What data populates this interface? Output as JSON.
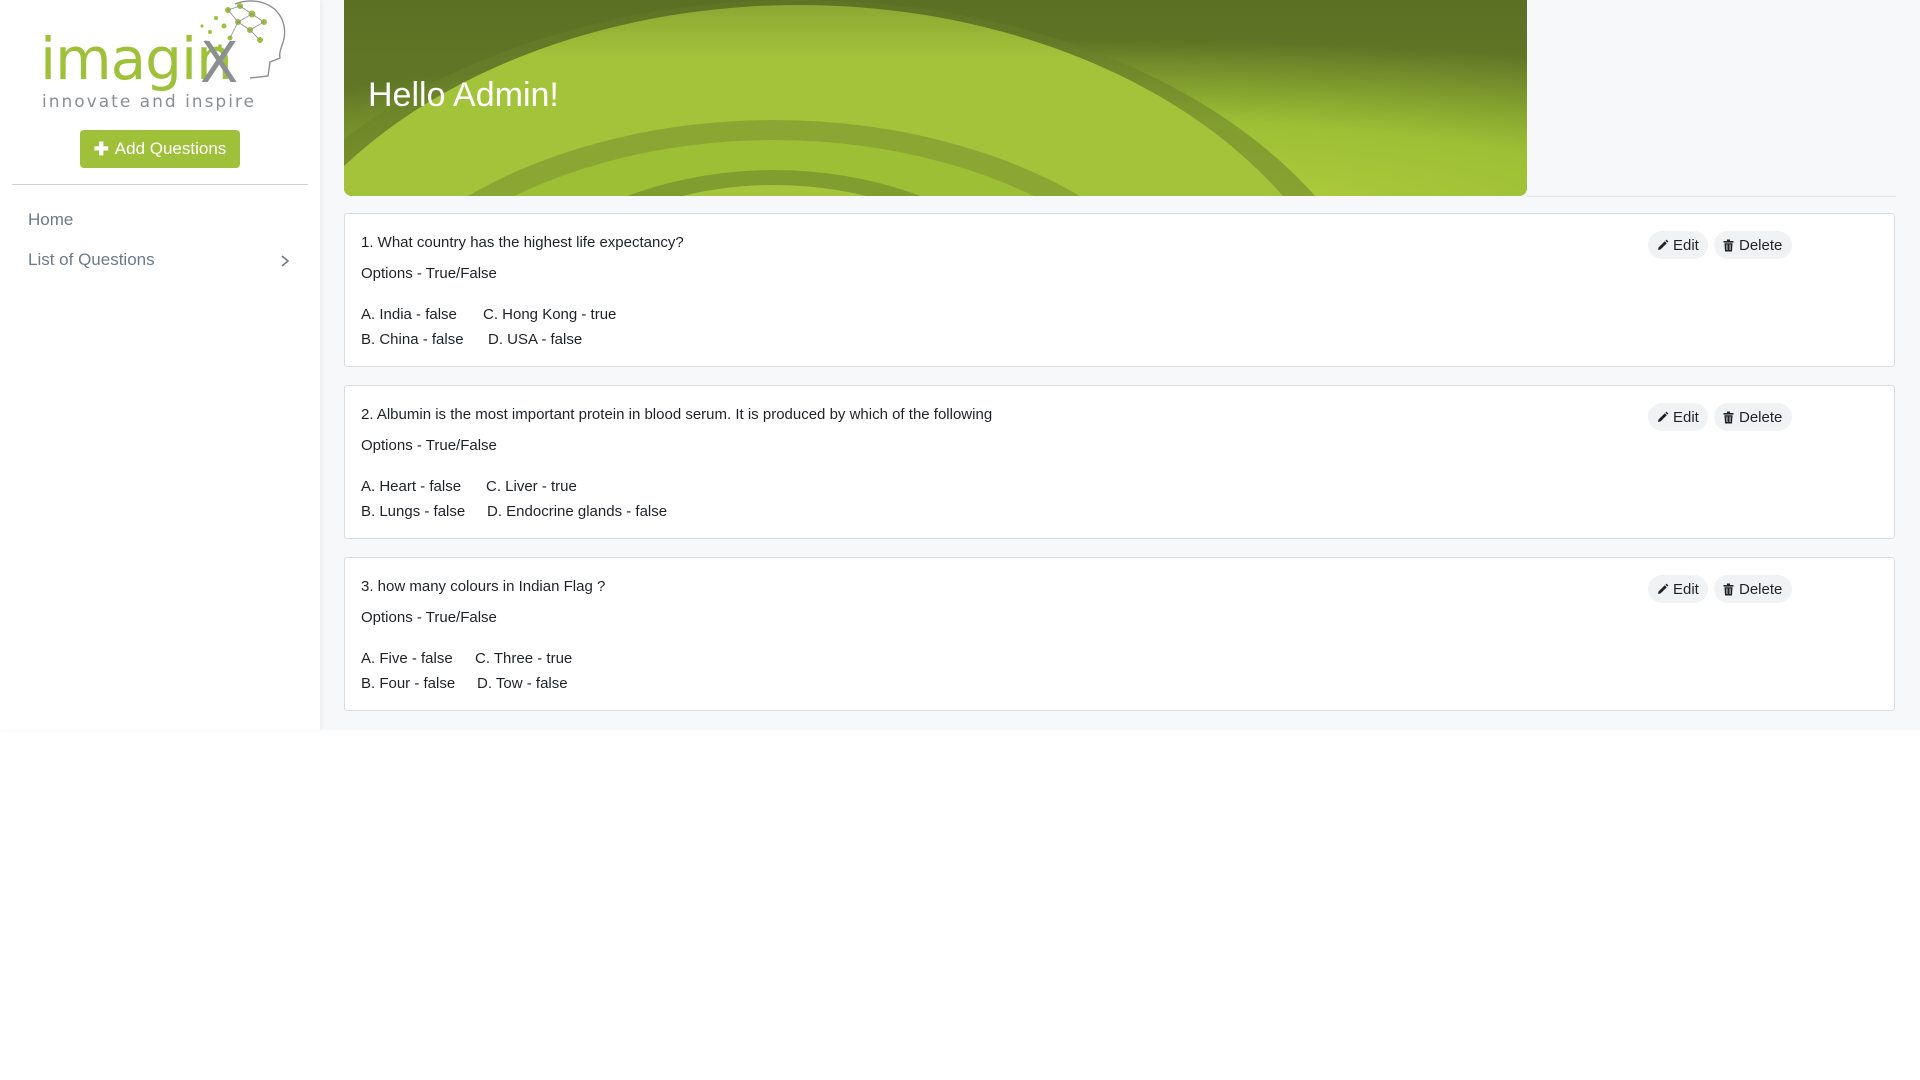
{
  "brand": {
    "name": "imagin",
    "mark": "X",
    "tagline": "innovate and inspire",
    "primary_color": "#9fc13a"
  },
  "sidebar": {
    "add_button": {
      "icon": "plus-icon",
      "label": "Add Questions"
    },
    "items": [
      {
        "label": "Home"
      },
      {
        "label": "List of Questions",
        "icon": "chevron-right-icon"
      }
    ]
  },
  "banner": {
    "title": "Hello Admin!"
  },
  "actions": {
    "edit_label": "Edit",
    "delete_label": "Delete",
    "edit_icon": "pencil-icon",
    "delete_icon": "trash-icon"
  },
  "questions": [
    {
      "text": "1. What country has the highest life expectancy?",
      "type": "Options - True/False",
      "options": {
        "a": "A. India - false",
        "b": "B. China - false",
        "c": "C. Hong Kong - true",
        "d": "D. USA - false"
      }
    },
    {
      "text": "2. Albumin is the most important protein in blood serum. It is produced by which of the following",
      "type": "Options - True/False",
      "options": {
        "a": "A. Heart - false",
        "b": "B. Lungs - false",
        "c": "C. Liver - true",
        "d": "D. Endocrine glands - false"
      }
    },
    {
      "text": "3. how many colours in Indian Flag ?",
      "type": "Options - True/False",
      "options": {
        "a": "A. Five - false",
        "b": "B. Four - false",
        "c": "C. Three - true",
        "d": "D. Tow - false"
      }
    }
  ]
}
